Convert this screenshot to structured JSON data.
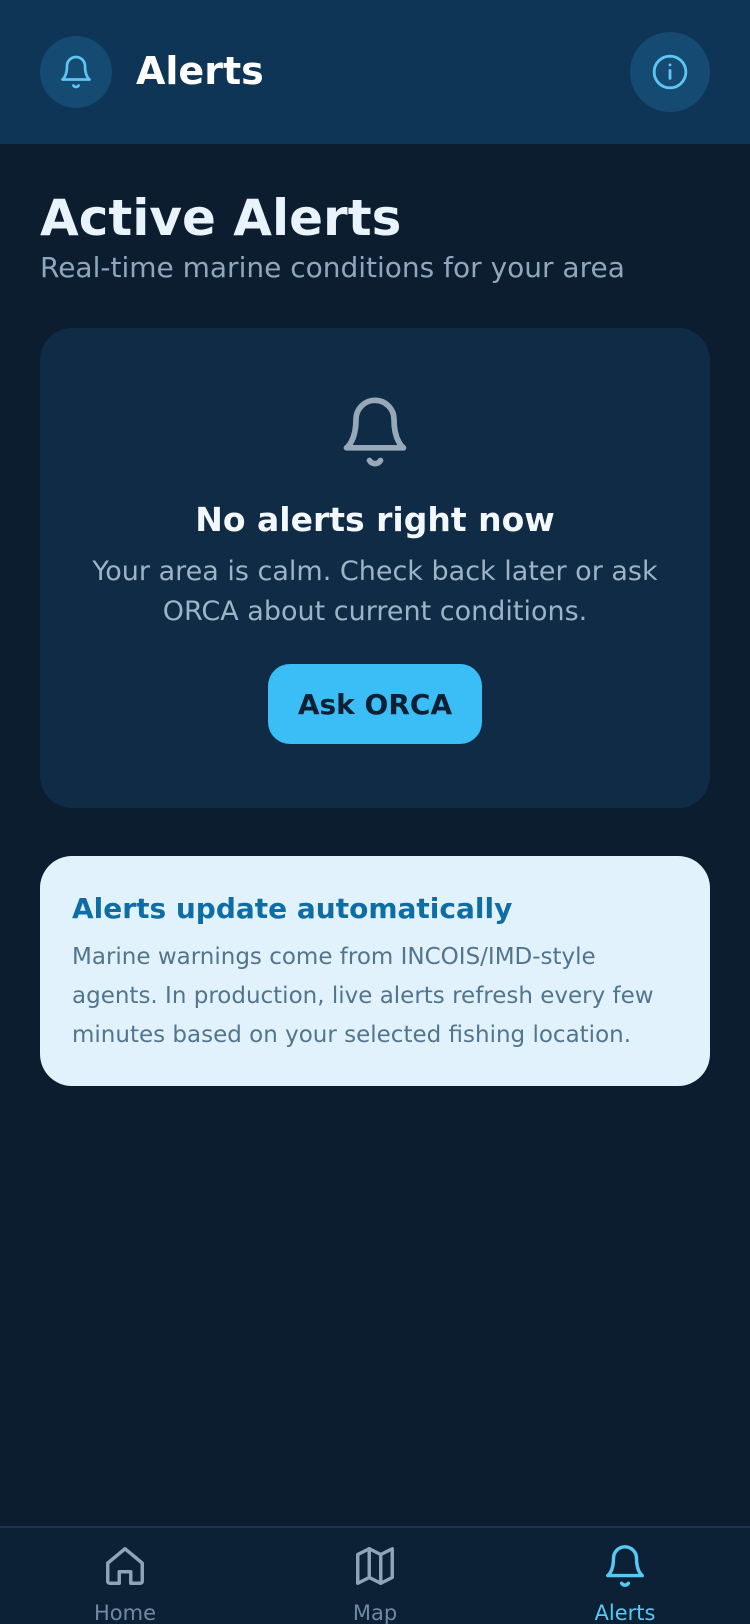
{
  "header": {
    "title": "Alerts",
    "bell_icon": "bell-icon",
    "info_icon": "info-icon"
  },
  "page": {
    "title": "Active Alerts",
    "subtitle": "Real-time marine conditions for your area"
  },
  "empty_state": {
    "icon": "bell-icon",
    "title": "No alerts right now",
    "text": "Your area is calm. Check back later or ask ORCA about current conditions.",
    "button_label": "Ask ORCA"
  },
  "info_card": {
    "title": "Alerts update automatically",
    "text": "Marine warnings come from INCOIS/IMD-style agents. In production, live alerts refresh every few minutes based on your selected fishing location."
  },
  "nav": {
    "items": [
      {
        "label": "Home",
        "icon": "home-icon",
        "active": false
      },
      {
        "label": "Map",
        "icon": "map-icon",
        "active": false
      },
      {
        "label": "Alerts",
        "icon": "bell-icon",
        "active": true
      }
    ]
  },
  "colors": {
    "background": "#0b1d2f",
    "header": "#0f3556",
    "accent": "#3bbdf6",
    "card": "#102b46",
    "info_card": "#e2f2fd",
    "active_nav": "#58c8f5"
  }
}
